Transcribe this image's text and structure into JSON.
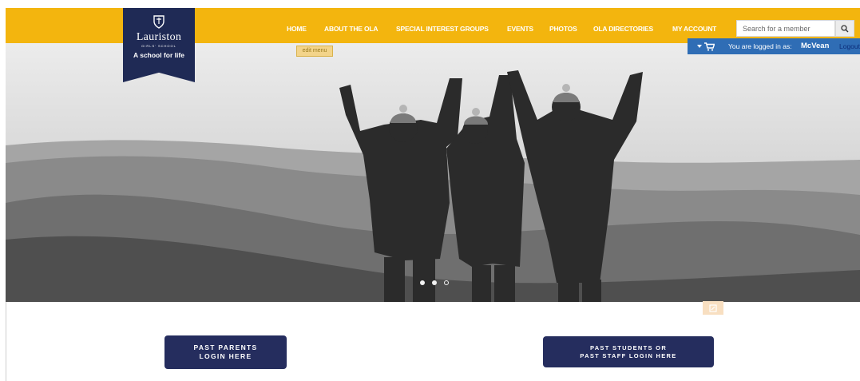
{
  "logo": {
    "name": "Lauriston",
    "subtitle": "GIRLS' SCHOOL",
    "tagline": "A school for life"
  },
  "nav": {
    "items": [
      {
        "label": "HOME"
      },
      {
        "label": "ABOUT THE OLA"
      },
      {
        "label": "SPECIAL INTEREST GROUPS"
      },
      {
        "label": "EVENTS"
      },
      {
        "label": "PHOTOS"
      },
      {
        "label": "OLA DIRECTORIES"
      },
      {
        "label": "MY ACCOUNT"
      }
    ],
    "edit_menu": "edit menu"
  },
  "search": {
    "placeholder": "Search for a member",
    "icon": "search-icon"
  },
  "login_bar": {
    "prefix": "You are logged in as:",
    "user": "McVean",
    "logout": "Logout",
    "icon": "cart-icon"
  },
  "slider": {
    "total": 3,
    "active": 2
  },
  "cta": {
    "parents": {
      "line1": "PAST PARENTS",
      "line2": "LOGIN HERE"
    },
    "students": {
      "line1": "PAST STUDENTS OR",
      "line2": "PAST STAFF LOGIN HERE"
    }
  },
  "colors": {
    "header": "#f3b50e",
    "navy": "#252d5e",
    "login_bar": "#2f6db5"
  }
}
